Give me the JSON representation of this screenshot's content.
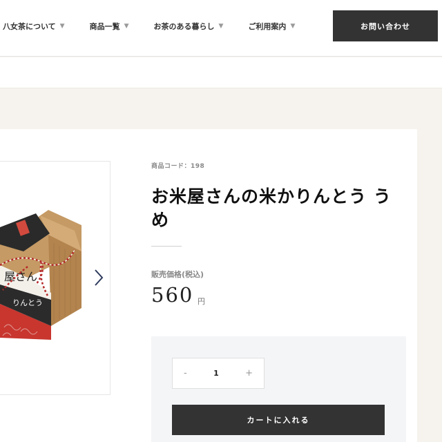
{
  "nav": {
    "items": [
      {
        "label": "八女茶について"
      },
      {
        "label": "商品一覧"
      },
      {
        "label": "お茶のある暮らし"
      },
      {
        "label": "ご利用案内"
      }
    ],
    "caret": "▼",
    "contact_label": "お問い合わせ"
  },
  "product": {
    "code": "商品コード：198",
    "title": "お米屋さんの米かりんとう うめ",
    "price_label": "販売価格(税込)",
    "price": "560",
    "currency": "円",
    "image_icon": "product-photo"
  },
  "purchase": {
    "minus": "-",
    "quantity": "1",
    "plus": "+",
    "cart_label": "カートに入れる"
  },
  "colors": {
    "dark_button": "#333333",
    "page_background": "#f6f3ee",
    "package_red": "#c8362e",
    "kraft": "#b88a55"
  }
}
